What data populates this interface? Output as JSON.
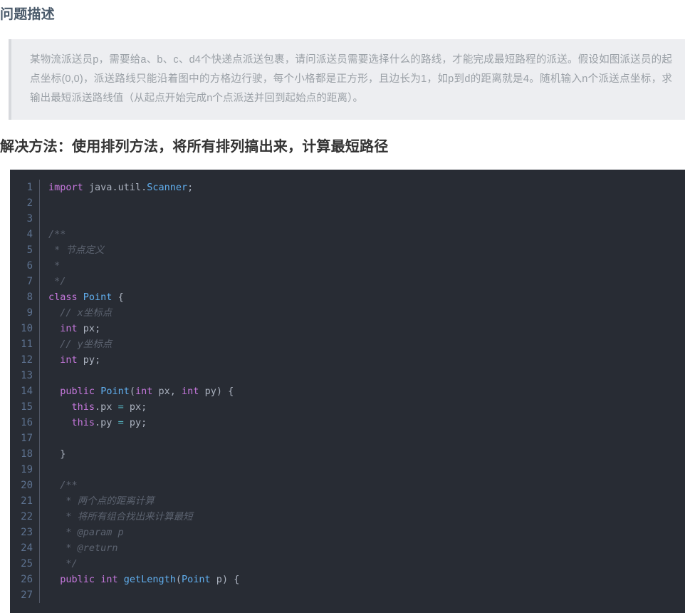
{
  "sections": {
    "problem": {
      "heading": "问题描述",
      "description": "某物流派送员p，需要给a、b、c、d4个快递点派送包裹，请问派送员需要选择什么的路线，才能完成最短路程的派送。假设如图派送员的起点坐标(0,0)，派送路线只能沿着图中的方格边行驶，每个小格都是正方形，且边长为1，如p到d的距离就是4。随机输入n个派送点坐标，求输出最短派送路线值（从起点开始完成n个点派送并回到起始点的距离）。"
    },
    "solution": {
      "heading": "解决方法：使用排列方法，将所有排列搞出来，计算最短路径"
    }
  },
  "code": {
    "language": "java",
    "theme": "atom-one-dark",
    "line_numbers": [
      1,
      2,
      3,
      4,
      5,
      6,
      7,
      8,
      9,
      10,
      11,
      12,
      13,
      14,
      15,
      16,
      17,
      18,
      19,
      20,
      21,
      22,
      23,
      24,
      25,
      26,
      27
    ],
    "lines": [
      "import java.util.Scanner;",
      "",
      "",
      "/**",
      " * 节点定义",
      " *",
      " */",
      "class Point {",
      "  // x坐标点",
      "  int px;",
      "  // y坐标点",
      "  int py;",
      "",
      "  public Point(int px, int py) {",
      "    this.px = px;",
      "    this.py = py;",
      "",
      "  }",
      "",
      "  /**",
      "   * 两个点的距离计算",
      "   * 将所有组合找出来计算最短",
      "   * @param p",
      "   * @return",
      "   */",
      "  public int getLength(Point p) {",
      ""
    ]
  },
  "colors": {
    "quote_bg": "#edeef1",
    "quote_border": "#d7d9dd",
    "quote_text": "#9aa0a6",
    "heading_1": "#4a5a6a",
    "heading_2": "#333333",
    "code_bg": "#282c34",
    "code_text": "#abb2bf",
    "gutter_text": "#5d7290",
    "keyword": "#c678dd",
    "type": "#61afef",
    "comment": "#5c6370",
    "operator": "#56b6c2"
  }
}
